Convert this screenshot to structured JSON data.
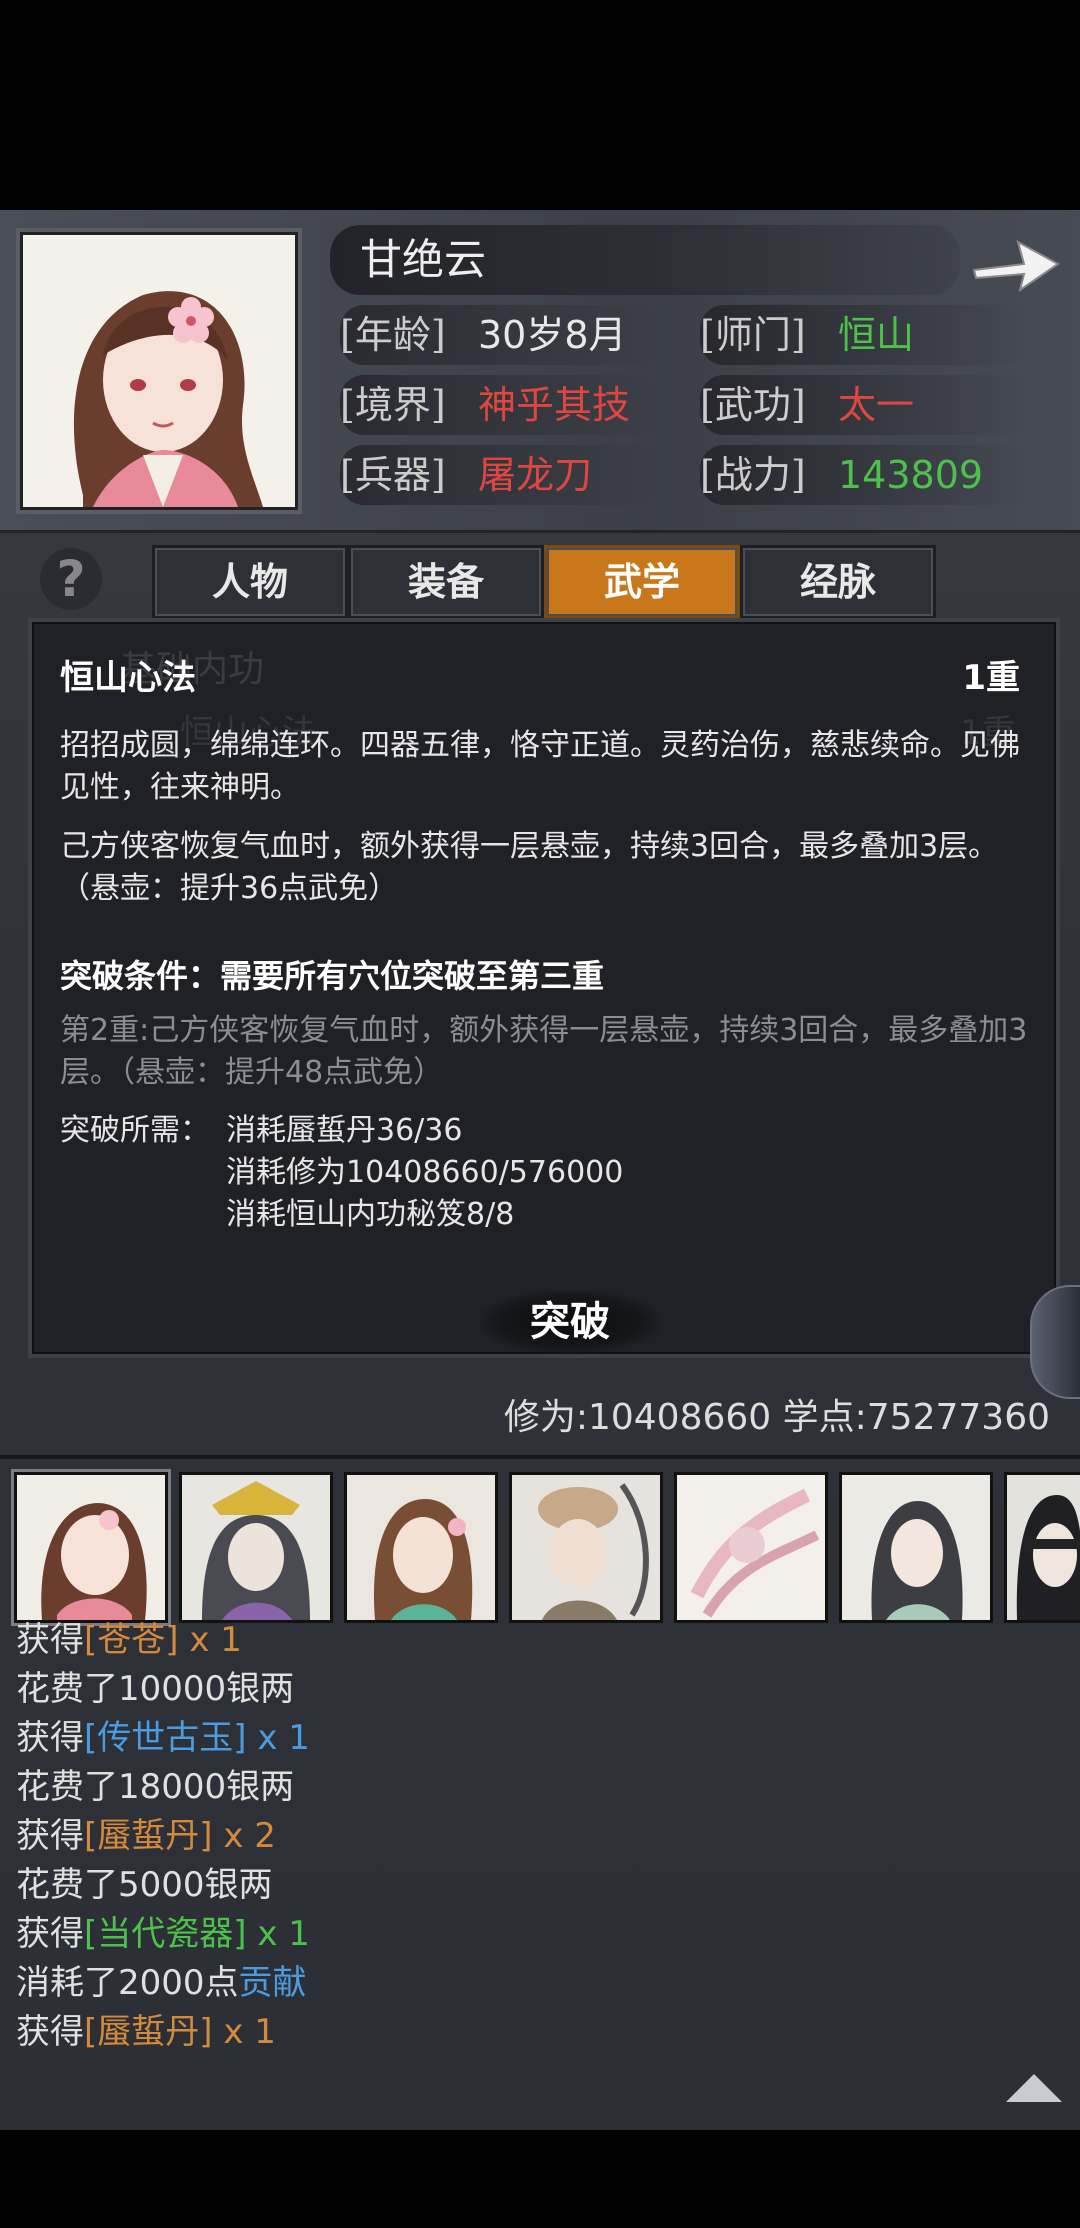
{
  "header": {
    "name": "甘绝云",
    "stats": [
      {
        "label": "[年龄]",
        "value": "30岁8月",
        "color": "#e8e8e8"
      },
      {
        "label": "[师门]",
        "value": "恒山",
        "color": "#4cc24a"
      },
      {
        "label": "[境界]",
        "value": "神乎其技",
        "color": "#e0463f"
      },
      {
        "label": "[武功]",
        "value": "太一",
        "color": "#e0463f"
      },
      {
        "label": "[兵器]",
        "value": "屠龙刀",
        "color": "#e0463f"
      },
      {
        "label": "[战力]",
        "value": "143809",
        "color": "#4cc24a"
      }
    ]
  },
  "tabs": [
    {
      "label": "人物",
      "active": false
    },
    {
      "label": "装备",
      "active": false
    },
    {
      "label": "武学",
      "active": true
    },
    {
      "label": "经脉",
      "active": false
    }
  ],
  "help_label": "?",
  "panel": {
    "ghost_title": "基础内功",
    "ghost_item": "恒山心法",
    "ghost_level": "1重",
    "skill_name": "恒山心法",
    "skill_level": "1重",
    "description": "招招成圆，绵绵连环。四器五律，恪守正道。灵药治伤，慈悲续命。见佛见性，往来神明。",
    "effect": "己方侠客恢复气血时，额外获得一层悬壶，持续3回合，最多叠加3层。（悬壶：提升36点武免）",
    "break_condition": "突破条件：需要所有穴位突破至第三重",
    "next_level": "第2重:己方侠客恢复气血时，额外获得一层悬壶，持续3回合，最多叠加3层。（悬壶：提升48点武免）",
    "requirements_label": "突破所需：",
    "requirements": [
      "消耗蜃蜇丹36/36",
      "消耗修为10408660/576000",
      "消耗恒山内功秘笈8/8"
    ],
    "breakthrough_button": "突破"
  },
  "points": "修为:10408660  学点:75277360",
  "log": [
    [
      {
        "t": "获得",
        "c": ""
      },
      {
        "t": "[苍苍]",
        "c": "c-orange"
      },
      {
        "t": " x 1",
        "c": "c-orange"
      }
    ],
    [
      {
        "t": "花费了10000银两",
        "c": ""
      }
    ],
    [
      {
        "t": "获得",
        "c": ""
      },
      {
        "t": "[传世古玉]",
        "c": "c-blue"
      },
      {
        "t": " x 1",
        "c": "c-blue"
      }
    ],
    [
      {
        "t": "花费了18000银两",
        "c": ""
      }
    ],
    [
      {
        "t": "获得",
        "c": ""
      },
      {
        "t": "[蜃蜇丹]",
        "c": "c-orange"
      },
      {
        "t": " x 2",
        "c": "c-orange"
      }
    ],
    [
      {
        "t": "花费了5000银两",
        "c": ""
      }
    ],
    [
      {
        "t": "获得",
        "c": ""
      },
      {
        "t": "[当代瓷器]",
        "c": "c-green"
      },
      {
        "t": " x 1",
        "c": "c-green"
      }
    ],
    [
      {
        "t": "消耗了2000点",
        "c": ""
      },
      {
        "t": "贡献",
        "c": "c-blue"
      }
    ],
    [
      {
        "t": "获得",
        "c": ""
      },
      {
        "t": "[蜃蜇丹]",
        "c": "c-orange"
      },
      {
        "t": " x 1",
        "c": "c-orange"
      }
    ]
  ],
  "icons": {
    "next": "arrow-right-icon",
    "help": "question-icon",
    "scroll_up": "triangle-up-icon"
  }
}
